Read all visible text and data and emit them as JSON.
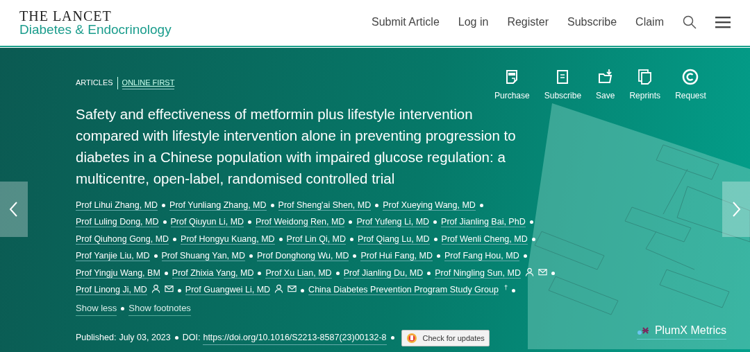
{
  "header": {
    "logo_top": "THE LANCET",
    "logo_bottom": "Diabetes & Endocrinology",
    "nav": [
      "Submit Article",
      "Log in",
      "Register",
      "Subscribe",
      "Claim"
    ]
  },
  "article": {
    "type": "ARTICLES",
    "section": "ONLINE FIRST",
    "actions": [
      {
        "kind": "pdf",
        "label": "Purchase"
      },
      {
        "kind": "book",
        "label": "Subscribe"
      },
      {
        "kind": "folder",
        "label": "Save"
      },
      {
        "kind": "pages",
        "label": "Reprints"
      },
      {
        "kind": "copyright",
        "label": "Request"
      }
    ],
    "title": "Safety and effectiveness of metformin plus lifestyle intervention compared with lifestyle intervention alone in preventing progression to diabetes in a Chinese population with impaired glucose regulation: a multicentre, open-label, randomised controlled trial",
    "author_lines": [
      [
        {
          "name": "Prof Lihui Zhang, MD",
          "contact": false
        },
        {
          "name": "Prof Yunliang Zhang, MD",
          "contact": false
        },
        {
          "name": "Prof Sheng'ai Shen, MD",
          "contact": false
        },
        {
          "name": "Prof Xueying Wang, MD",
          "contact": false
        }
      ],
      [
        {
          "name": "Prof Luling Dong, MD",
          "contact": false
        },
        {
          "name": "Prof Qiuyun Li, MD",
          "contact": false
        },
        {
          "name": "Prof Weidong Ren, MD",
          "contact": false
        },
        {
          "name": "Prof Yufeng Li, MD",
          "contact": false
        },
        {
          "name": "Prof Jianling Bai, PhD",
          "contact": false
        }
      ],
      [
        {
          "name": "Prof Qiuhong Gong, MD",
          "contact": false
        },
        {
          "name": "Prof Hongyu Kuang, MD",
          "contact": false
        },
        {
          "name": "Prof Lin Qi, MD",
          "contact": false
        },
        {
          "name": "Prof Qiang Lu, MD",
          "contact": false
        },
        {
          "name": "Prof Wenli Cheng, MD",
          "contact": false
        }
      ],
      [
        {
          "name": "Prof Yanjie Liu, MD",
          "contact": false
        },
        {
          "name": "Prof Shuang Yan, MD",
          "contact": false
        },
        {
          "name": "Prof Donghong Wu, MD",
          "contact": false
        },
        {
          "name": "Prof Hui Fang, MD",
          "contact": false
        },
        {
          "name": "Prof Fang Hou, MD",
          "contact": false
        }
      ],
      [
        {
          "name": "Prof Yingju Wang, BM",
          "contact": false
        },
        {
          "name": "Prof Zhixia Yang, MD",
          "contact": false
        },
        {
          "name": "Prof Xu Lian, MD",
          "contact": false
        },
        {
          "name": "Prof Jianling Du, MD",
          "contact": false
        },
        {
          "name": "Prof Ningling Sun, MD",
          "contact": true
        }
      ],
      [
        {
          "name": "Prof Linong Ji, MD",
          "contact": true
        },
        {
          "name": "Prof Guangwei Li, MD",
          "contact": true
        },
        {
          "name": "China Diabetes Prevention Program Study Group",
          "contact": false,
          "footnote": "†"
        }
      ]
    ],
    "toggles": [
      "Show less",
      "Show footnotes"
    ],
    "published_label": "Published:",
    "published": "July 03, 2023",
    "doi_label": "DOI:",
    "doi": "https://doi.org/10.1016/S2213-8587(23)00132-8",
    "updates_button": "Check for updates",
    "metrics": "PlumX Metrics"
  }
}
